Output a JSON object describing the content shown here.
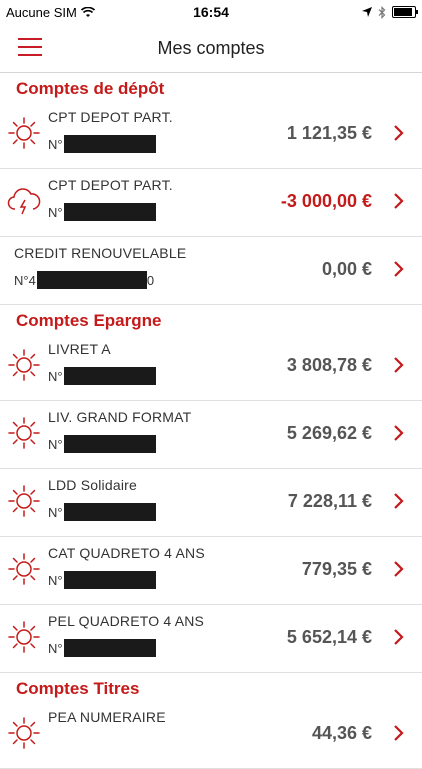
{
  "status": {
    "carrier": "Aucune SIM",
    "time": "16:54"
  },
  "nav": {
    "title": "Mes comptes"
  },
  "sections": {
    "depot": {
      "title": "Comptes de dépôt",
      "items": [
        {
          "name": "CPT DEPOT PART.",
          "num": "N°",
          "amount": "1 121,35 €"
        },
        {
          "name": "CPT DEPOT PART.",
          "num": "N°",
          "amount": "-3 000,00 €"
        },
        {
          "name": "CREDIT RENOUVELABLE",
          "num": "N°4",
          "num_suffix": "0",
          "amount": "0,00 €"
        }
      ]
    },
    "epargne": {
      "title": "Comptes Epargne",
      "items": [
        {
          "name": "LIVRET A",
          "num": "N°",
          "amount": "3 808,78 €"
        },
        {
          "name": "LIV. GRAND FORMAT",
          "num": "N°",
          "amount": "5 269,62 €"
        },
        {
          "name": "LDD Solidaire",
          "num": "N°",
          "amount": "7 228,11 €"
        },
        {
          "name": "CAT QUADRETO 4 ANS",
          "num": "N°",
          "amount": "779,35 €"
        },
        {
          "name": "PEL QUADRETO 4 ANS",
          "num": "N°",
          "amount": "5 652,14 €"
        }
      ]
    },
    "titres": {
      "title": "Comptes Titres",
      "items": [
        {
          "name": "PEA NUMERAIRE",
          "amount": "44,36 €"
        }
      ]
    }
  },
  "colors": {
    "accent": "#c41a1a",
    "amount": "#555555"
  }
}
